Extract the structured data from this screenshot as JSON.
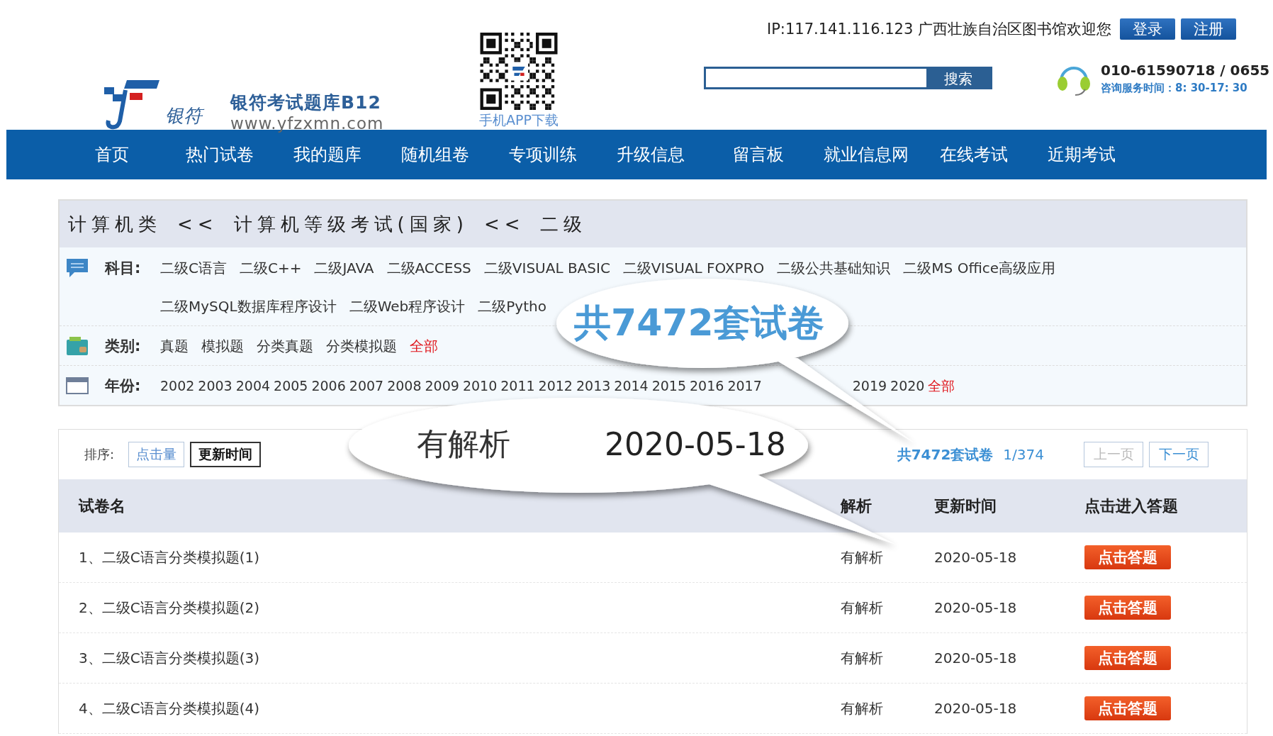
{
  "header": {
    "logo_text": "银符",
    "site_name": "银符考试题库B12",
    "site_url": "www.yfzxmn.com",
    "app_download": "手机APP下载",
    "welcome": "IP:117.141.116.123 广西壮族自治区图书馆欢迎您",
    "login": "登录",
    "register": "注册",
    "search_button": "搜索",
    "phone": "010-61590718 / 0655",
    "service_hours": "咨询服务时间：8: 30-17: 30"
  },
  "nav": [
    {
      "label": "首页"
    },
    {
      "label": "热门试卷"
    },
    {
      "label": "我的题库"
    },
    {
      "label": "随机组卷"
    },
    {
      "label": "专项训练"
    },
    {
      "label": "升级信息"
    },
    {
      "label": "留言板"
    },
    {
      "label": "就业信息网"
    },
    {
      "label": "在线考试"
    },
    {
      "label": "近期考试"
    }
  ],
  "breadcrumb": [
    "计算机类",
    "<<",
    "计算机等级考试(国家)",
    "<<",
    "二级"
  ],
  "filters": [
    {
      "kind": "subject",
      "label": "科目:",
      "options": [
        {
          "label": "二级C语言",
          "selected": false
        },
        {
          "label": "二级C++",
          "selected": false
        },
        {
          "label": "二级JAVA",
          "selected": false
        },
        {
          "label": "二级ACCESS",
          "selected": false
        },
        {
          "label": "二级VISUAL BASIC",
          "selected": false
        },
        {
          "label": "二级VISUAL FOXPRO",
          "selected": false
        },
        {
          "label": "二级公共基础知识",
          "selected": false
        },
        {
          "label": "二级MS Office高级应用",
          "selected": false
        },
        {
          "label": "二级MySQL数据库程序设计",
          "selected": false
        },
        {
          "label": "二级Web程序设计",
          "selected": false
        },
        {
          "label": "二级Pytho",
          "selected": false
        }
      ]
    },
    {
      "kind": "category",
      "label": "类别:",
      "options": [
        {
          "label": "真题",
          "selected": false
        },
        {
          "label": "模拟题",
          "selected": false
        },
        {
          "label": "分类真题",
          "selected": false
        },
        {
          "label": "分类模拟题",
          "selected": false
        },
        {
          "label": "全部",
          "selected": true
        }
      ]
    },
    {
      "kind": "year",
      "label": "年份:",
      "options": [
        {
          "label": "2002",
          "selected": false
        },
        {
          "label": "2003",
          "selected": false
        },
        {
          "label": "2004",
          "selected": false
        },
        {
          "label": "2005",
          "selected": false
        },
        {
          "label": "2006",
          "selected": false
        },
        {
          "label": "2007",
          "selected": false
        },
        {
          "label": "2008",
          "selected": false
        },
        {
          "label": "2009",
          "selected": false
        },
        {
          "label": "2010",
          "selected": false
        },
        {
          "label": "2011",
          "selected": false
        },
        {
          "label": "2012",
          "selected": false
        },
        {
          "label": "2013",
          "selected": false
        },
        {
          "label": "2014",
          "selected": false
        },
        {
          "label": "2015",
          "selected": false
        },
        {
          "label": "2016",
          "selected": false
        },
        {
          "label": "2017",
          "selected": false
        },
        {
          "label": "2019",
          "selected": false
        },
        {
          "label": "2020",
          "selected": false
        },
        {
          "label": "全部",
          "selected": true
        }
      ]
    }
  ],
  "list": {
    "sort_label": "排序:",
    "sort_options": [
      {
        "label": "点击量",
        "selected": false
      },
      {
        "label": "更新时间",
        "selected": true
      }
    ],
    "count": "共7472套试卷",
    "page": "1/374",
    "prev": {
      "label": "上一页",
      "disabled": true
    },
    "next": {
      "label": "下一页",
      "disabled": false
    },
    "columns": [
      "试卷名",
      "解析",
      "更新时间",
      "点击进入答题"
    ],
    "rows": [
      {
        "name": "1、二级C语言分类模拟题(1)",
        "analysis": "有解析",
        "updated": "2020-05-18",
        "action": "点击答题"
      },
      {
        "name": "2、二级C语言分类模拟题(2)",
        "analysis": "有解析",
        "updated": "2020-05-18",
        "action": "点击答题"
      },
      {
        "name": "3、二级C语言分类模拟题(3)",
        "analysis": "有解析",
        "updated": "2020-05-18",
        "action": "点击答题"
      },
      {
        "name": "4、二级C语言分类模拟题(4)",
        "analysis": "有解析",
        "updated": "2020-05-18",
        "action": "点击答题"
      }
    ]
  },
  "callouts": [
    {
      "texts": [
        "共7472套试卷"
      ]
    },
    {
      "texts": [
        "有解析",
        "2020-05-18"
      ]
    }
  ]
}
